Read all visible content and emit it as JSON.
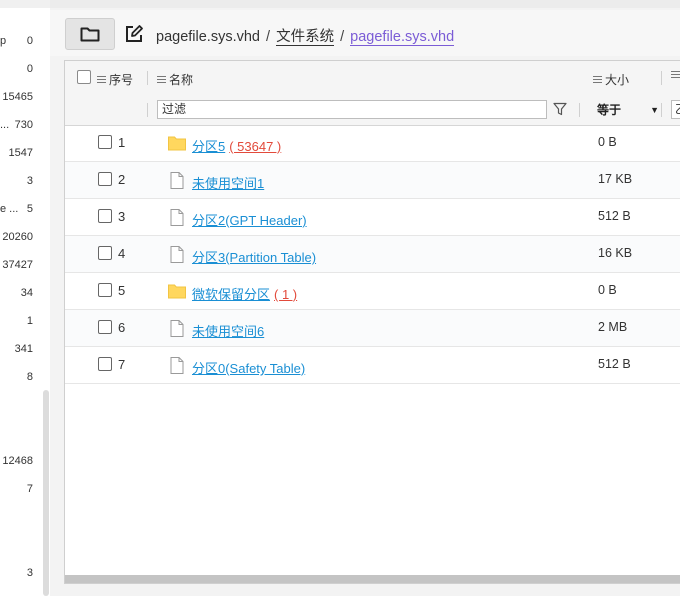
{
  "left_pane": {
    "numbers": [
      {
        "text": "0"
      },
      {
        "text": "0"
      },
      {
        "text": "15465"
      },
      {
        "text": "730"
      },
      {
        "text": "1547"
      },
      {
        "text": "3"
      },
      {
        "text": "5"
      },
      {
        "text": "20260"
      },
      {
        "text": "37427"
      },
      {
        "text": "34"
      },
      {
        "text": "1"
      },
      {
        "text": "341"
      },
      {
        "text": "8"
      },
      {
        "text": "12468"
      },
      {
        "text": "7"
      },
      {
        "text": "3"
      }
    ],
    "cut_labels": {
      "p": "p",
      "dots": "...",
      "e": "e ..."
    }
  },
  "toolbar": {
    "folder_icon": "folder-icon",
    "edit_icon": "edit-icon"
  },
  "breadcrumb": {
    "root": "pagefile.sys.vhd",
    "sep1": "/",
    "middle": "文件系统",
    "sep2": "/",
    "current": "pagefile.sys.vhd"
  },
  "grid": {
    "columns": {
      "index": "序号",
      "name": "名称",
      "size": "大小"
    },
    "filter": {
      "placeholder": "过滤",
      "operator": "等于",
      "next_cut": "乙"
    },
    "rows": [
      {
        "index": "1",
        "type": "folder",
        "name": "分区5",
        "count": "( 53647 )",
        "size": "0 B"
      },
      {
        "index": "2",
        "type": "file",
        "name": "未使用空间1",
        "count": "",
        "size": "17 KB"
      },
      {
        "index": "3",
        "type": "file",
        "name": "分区2(GPT Header)",
        "count": "",
        "size": "512 B"
      },
      {
        "index": "4",
        "type": "file",
        "name": "分区3(Partition Table)",
        "count": "",
        "size": "16 KB"
      },
      {
        "index": "5",
        "type": "folder",
        "name": "微软保留分区",
        "count": "( 1 )",
        "size": "0 B"
      },
      {
        "index": "6",
        "type": "file",
        "name": "未使用空间6",
        "count": "",
        "size": "2 MB"
      },
      {
        "index": "7",
        "type": "file",
        "name": "分区0(Safety Table)",
        "count": "",
        "size": "512 B"
      }
    ]
  },
  "colors": {
    "link": "#1a8fd4",
    "count": "#e24a3b",
    "breadcrumb_current": "#7b5cd6",
    "folder": "#ffd75e"
  }
}
